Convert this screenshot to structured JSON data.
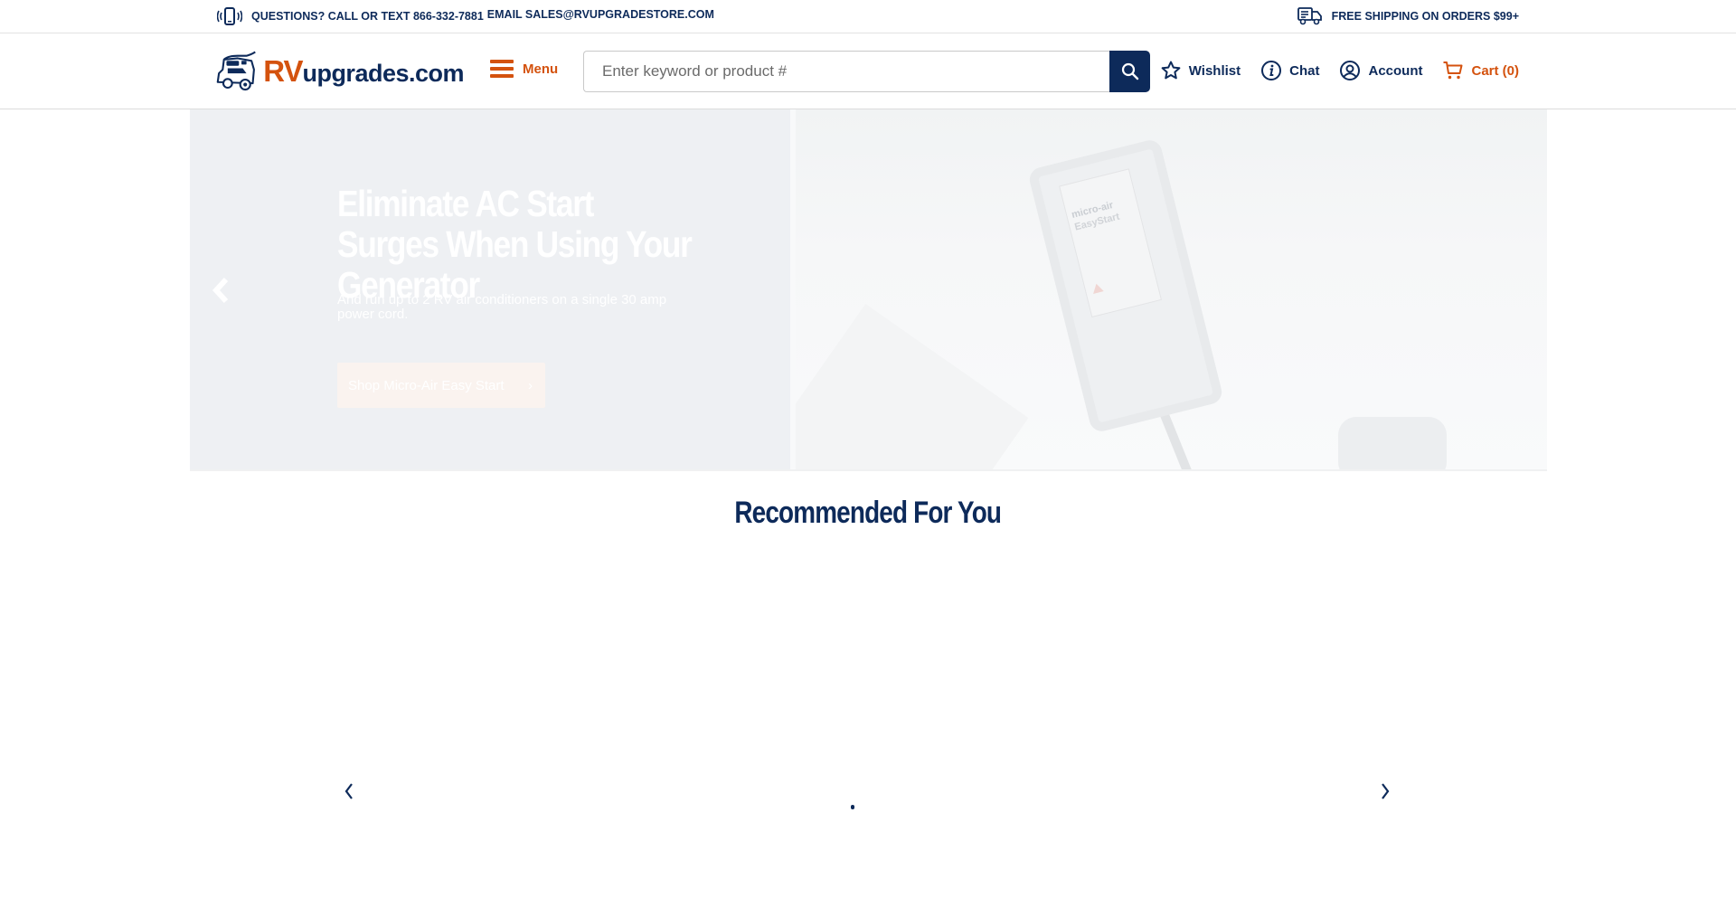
{
  "topbar": {
    "phone_text": "QUESTIONS? CALL OR TEXT 866-332-7881",
    "email_text": "EMAIL SALES@RVUPGRADESTORE.COM",
    "shipping_text": "FREE SHIPPING ON ORDERS $99+",
    "icons": {
      "phone": "phone-vibrate-icon",
      "shipping": "delivery-truck-icon"
    }
  },
  "header": {
    "logo": {
      "brand_accent": "RV",
      "brand_rest": "upgrades.com"
    },
    "menu_label": "Menu",
    "search": {
      "placeholder": "Enter keyword or product #",
      "value": ""
    },
    "actions": [
      {
        "label": "Wishlist",
        "icon": "star-icon"
      },
      {
        "label": "Chat",
        "icon": "info-icon"
      },
      {
        "label": "Account",
        "icon": "user-circle-icon"
      },
      {
        "label": "Cart (0)",
        "icon": "cart-icon"
      }
    ]
  },
  "hero": {
    "title": "Eliminate AC Start Surges When Using Your Generator",
    "subtitle": "And run up to 2 RV air conditioners on a single 30 amp power cord.",
    "cta_label": "Shop Micro-Air Easy Start",
    "product_brand": "micro-air",
    "product_name": "EasyStart"
  },
  "recommended": {
    "title": "Recommended For You",
    "page_dots": 1,
    "active_dot": 0
  },
  "colors": {
    "navy": "#0d2a5a",
    "orange": "#d4520e",
    "hero_bg": "#eef0f3"
  }
}
